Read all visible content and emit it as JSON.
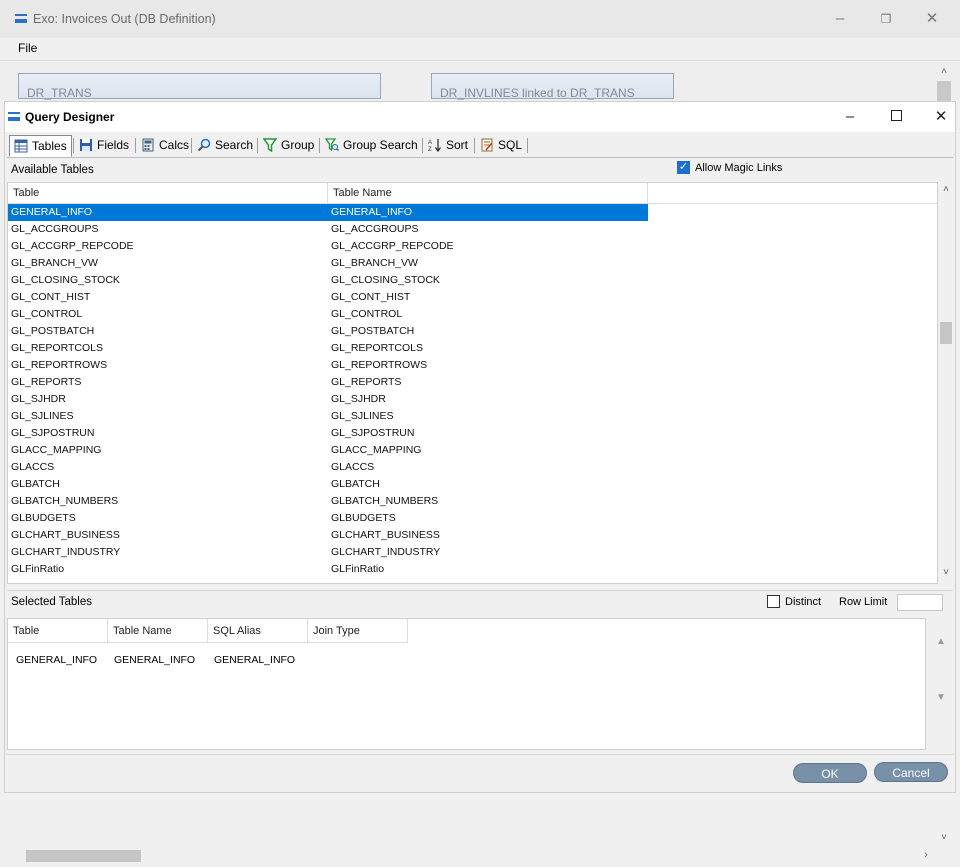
{
  "outer_window": {
    "title": "Exo: Invoices Out (DB Definition)",
    "menu": [
      "File"
    ],
    "table_boxes": [
      "DR_TRANS",
      "DR_INVLINES linked to DR_TRANS"
    ]
  },
  "dialog": {
    "title": "Query Designer",
    "tabs": [
      {
        "label": "Tables",
        "icon": "table-grid-icon"
      },
      {
        "label": "Fields",
        "icon": "floppy-disk-icon"
      },
      {
        "label": "Calcs",
        "icon": "calculator-icon"
      },
      {
        "label": "Search",
        "icon": "magnifier-icon"
      },
      {
        "label": "Group",
        "icon": "filter-funnel-icon"
      },
      {
        "label": "Group Search",
        "icon": "funnel-search-icon"
      },
      {
        "label": "Sort",
        "icon": "sort-az-icon"
      },
      {
        "label": "SQL",
        "icon": "sql-script-icon"
      }
    ],
    "active_tab": "Tables",
    "available_tables_label": "Available Tables",
    "allow_magic_links": {
      "label": "Allow Magic Links",
      "checked": true
    },
    "available_columns": [
      "Table",
      "Table Name"
    ],
    "available_rows": [
      [
        "GENERAL_INFO",
        "GENERAL_INFO"
      ],
      [
        "GL_ACCGROUPS",
        "GL_ACCGROUPS"
      ],
      [
        "GL_ACCGRP_REPCODE",
        "GL_ACCGRP_REPCODE"
      ],
      [
        "GL_BRANCH_VW",
        "GL_BRANCH_VW"
      ],
      [
        "GL_CLOSING_STOCK",
        "GL_CLOSING_STOCK"
      ],
      [
        "GL_CONT_HIST",
        "GL_CONT_HIST"
      ],
      [
        "GL_CONTROL",
        "GL_CONTROL"
      ],
      [
        "GL_POSTBATCH",
        "GL_POSTBATCH"
      ],
      [
        "GL_REPORTCOLS",
        "GL_REPORTCOLS"
      ],
      [
        "GL_REPORTROWS",
        "GL_REPORTROWS"
      ],
      [
        "GL_REPORTS",
        "GL_REPORTS"
      ],
      [
        "GL_SJHDR",
        "GL_SJHDR"
      ],
      [
        "GL_SJLINES",
        "GL_SJLINES"
      ],
      [
        "GL_SJPOSTRUN",
        "GL_SJPOSTRUN"
      ],
      [
        "GLACC_MAPPING",
        "GLACC_MAPPING"
      ],
      [
        "GLACCS",
        "GLACCS"
      ],
      [
        "GLBATCH",
        "GLBATCH"
      ],
      [
        "GLBATCH_NUMBERS",
        "GLBATCH_NUMBERS"
      ],
      [
        "GLBUDGETS",
        "GLBUDGETS"
      ],
      [
        "GLCHART_BUSINESS",
        "GLCHART_BUSINESS"
      ],
      [
        "GLCHART_INDUSTRY",
        "GLCHART_INDUSTRY"
      ],
      [
        "GLFinRatio",
        "GLFinRatio"
      ]
    ],
    "selected_row_index": 0,
    "selected_tables_label": "Selected Tables",
    "distinct": {
      "label": "Distinct",
      "checked": false
    },
    "row_limit": {
      "label": "Row Limit",
      "value": ""
    },
    "selected_columns": [
      "Table",
      "Table Name",
      "SQL Alias",
      "Join Type"
    ],
    "selected_rows": [
      [
        "GENERAL_INFO",
        "GENERAL_INFO",
        "GENERAL_INFO",
        ""
      ]
    ],
    "ok_label": "OK",
    "cancel_label": "Cancel"
  },
  "colors": {
    "selection": "#0078d7",
    "button": "#7890a8",
    "checkbox_checked": "#1a6fd1"
  }
}
